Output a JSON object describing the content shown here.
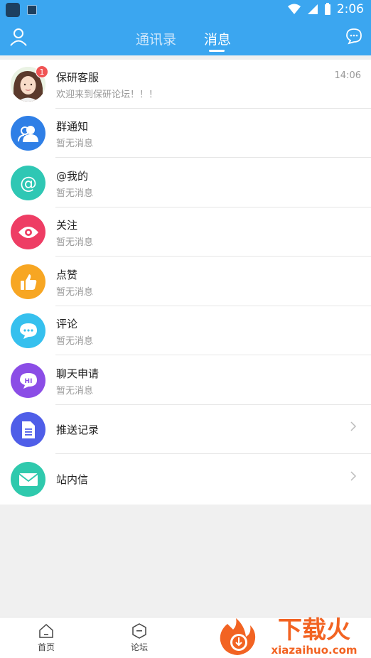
{
  "status": {
    "time": "2:06"
  },
  "header": {
    "tabs": [
      {
        "label": "通讯录",
        "active": false
      },
      {
        "label": "消息",
        "active": true
      }
    ]
  },
  "rows": [
    {
      "title": "保研客服",
      "subtitle": "欢迎来到保研论坛！！！",
      "time": "14:06",
      "badge": "1"
    },
    {
      "title": "群通知",
      "subtitle": "暂无消息"
    },
    {
      "title": "@我的",
      "subtitle": "暂无消息"
    },
    {
      "title": "关注",
      "subtitle": "暂无消息"
    },
    {
      "title": "点赞",
      "subtitle": "暂无消息"
    },
    {
      "title": "评论",
      "subtitle": "暂无消息"
    },
    {
      "title": "聊天申请",
      "subtitle": "暂无消息"
    },
    {
      "title": "推送记录"
    },
    {
      "title": "站内信"
    }
  ],
  "tabbar": {
    "items": [
      {
        "label": "首页"
      },
      {
        "label": "论坛"
      }
    ]
  },
  "colors": {
    "accent": "#3ba6f0",
    "badge": "#f05454"
  }
}
